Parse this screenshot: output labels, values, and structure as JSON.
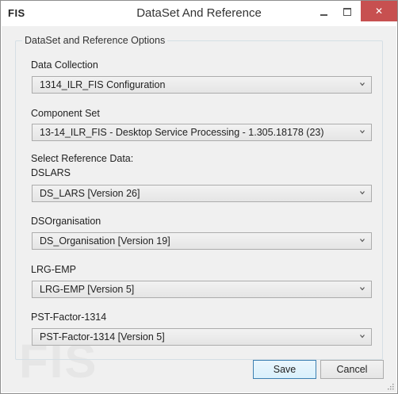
{
  "window": {
    "app_logo": "FIS",
    "title": "DataSet And Reference",
    "close_glyph": "✕"
  },
  "group": {
    "legend": "DataSet and Reference Options"
  },
  "fields": {
    "data_collection": {
      "label": "Data Collection",
      "value": "1314_ILR_FIS Configuration"
    },
    "component_set": {
      "label": "Component Set",
      "value": "13-14_ILR_FIS - Desktop Service Processing - 1.305.18178 (23)"
    },
    "reference_header": "Select Reference Data:",
    "dslars": {
      "label": "DSLARS",
      "value": "DS_LARS [Version 26]"
    },
    "dsorganisation": {
      "label": "DSOrganisation",
      "value": "DS_Organisation [Version 19]"
    },
    "lrg_emp": {
      "label": "LRG-EMP",
      "value": "LRG-EMP [Version 5]"
    },
    "pst_factor": {
      "label": "PST-Factor-1314",
      "value": "PST-Factor-1314 [Version 5]"
    }
  },
  "watermark": "FIS",
  "buttons": {
    "save": "Save",
    "cancel": "Cancel"
  },
  "icons": {
    "minimize": "minimize-icon",
    "maximize": "maximize-icon",
    "close": "close-icon",
    "dropdown": "chevron-down-icon",
    "resize": "resize-grip-icon"
  },
  "colors": {
    "close_button": "#c75050",
    "dialog_background": "#f0f0f0",
    "default_button_border": "#3c7fb1"
  }
}
